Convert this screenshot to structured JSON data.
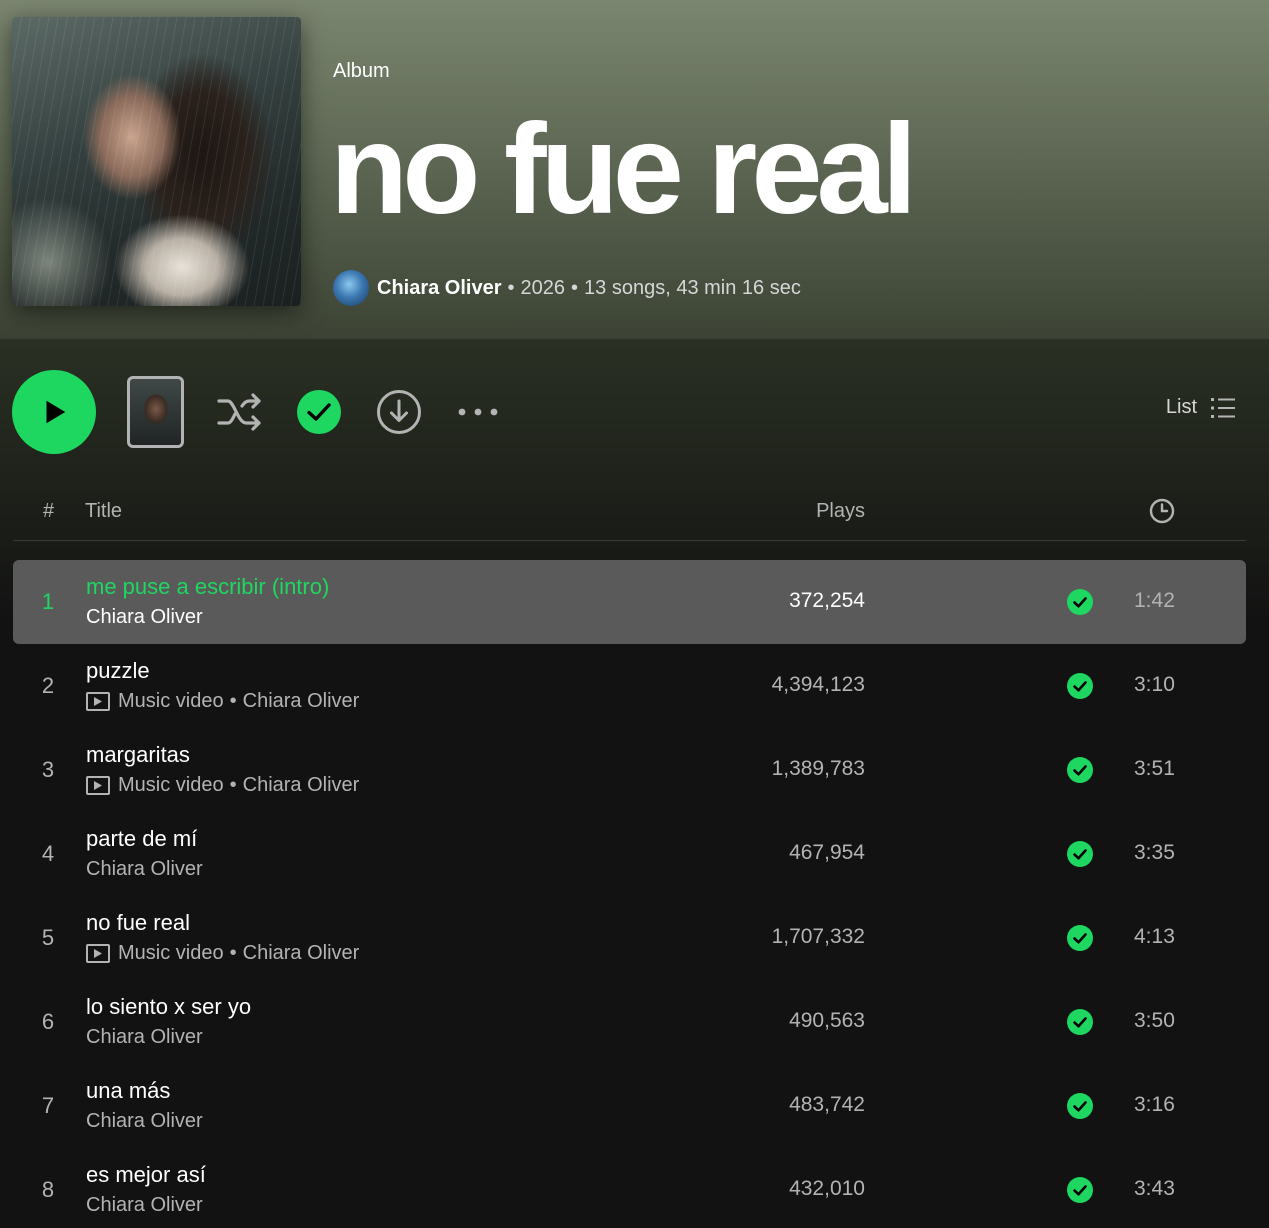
{
  "header": {
    "type_label": "Album",
    "title": "no fue real",
    "artist": "Chiara Oliver",
    "separator": "•",
    "year": "2026",
    "summary": "13 songs, 43 min 16 sec"
  },
  "actions": {
    "view_label": "List"
  },
  "table": {
    "col_num": "#",
    "col_title": "Title",
    "col_plays": "Plays"
  },
  "colors": {
    "accent": "#1ed760",
    "background": "#121212",
    "active_row": "#5a5a5a"
  },
  "tracks": [
    {
      "num": "1",
      "title": "me puse a escribir (intro)",
      "artist": "Chiara Oliver",
      "music_video": false,
      "plays": "372,254",
      "duration": "1:42",
      "active": true
    },
    {
      "num": "2",
      "title": "puzzle",
      "artist": "Chiara Oliver",
      "music_video": true,
      "mv_label": "Music video",
      "plays": "4,394,123",
      "duration": "3:10"
    },
    {
      "num": "3",
      "title": "margaritas",
      "artist": "Chiara Oliver",
      "music_video": true,
      "mv_label": "Music video",
      "plays": "1,389,783",
      "duration": "3:51"
    },
    {
      "num": "4",
      "title": "parte de mí",
      "artist": "Chiara Oliver",
      "music_video": false,
      "plays": "467,954",
      "duration": "3:35"
    },
    {
      "num": "5",
      "title": "no fue real",
      "artist": "Chiara Oliver",
      "music_video": true,
      "mv_label": "Music video",
      "plays": "1,707,332",
      "duration": "4:13"
    },
    {
      "num": "6",
      "title": "lo siento x ser yo",
      "artist": "Chiara Oliver",
      "music_video": false,
      "plays": "490,563",
      "duration": "3:50"
    },
    {
      "num": "7",
      "title": "una más",
      "artist": "Chiara Oliver",
      "music_video": false,
      "plays": "483,742",
      "duration": "3:16"
    },
    {
      "num": "8",
      "title": "es mejor así",
      "artist": "Chiara Oliver",
      "music_video": false,
      "plays": "432,010",
      "duration": "3:43"
    }
  ]
}
